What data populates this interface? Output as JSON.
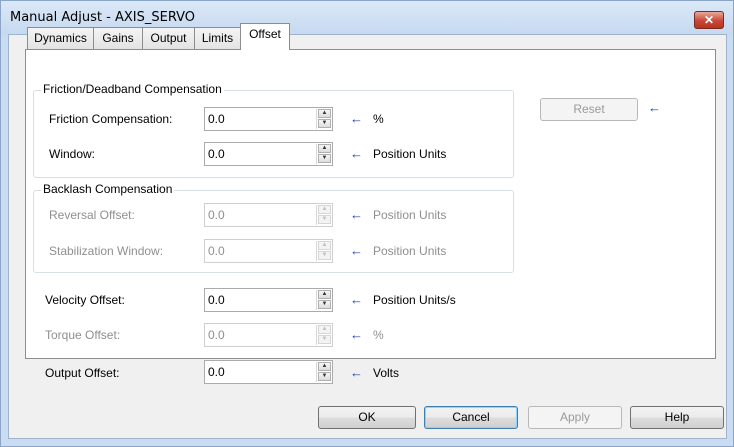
{
  "window": {
    "title": "Manual Adjust - AXIS_SERVO",
    "close_glyph": "✕"
  },
  "tabs": [
    {
      "label": "Dynamics"
    },
    {
      "label": "Gains"
    },
    {
      "label": "Output"
    },
    {
      "label": "Limits"
    },
    {
      "label": "Offset"
    }
  ],
  "friction": {
    "title": "Friction/Deadband Compensation",
    "friction_comp": {
      "label": "Friction Compensation:",
      "value": "0.0",
      "unit": "%"
    },
    "window": {
      "label": "Window:",
      "value": "0.0",
      "unit": "Position Units"
    }
  },
  "backlash": {
    "title": "Backlash Compensation",
    "reversal_offset": {
      "label": "Reversal Offset:",
      "value": "0.0",
      "unit": "Position Units"
    },
    "stabilization_window": {
      "label": "Stabilization Window:",
      "value": "0.0",
      "unit": "Position Units"
    }
  },
  "offsets": {
    "velocity": {
      "label": "Velocity Offset:",
      "value": "0.0",
      "unit": "Position Units/s"
    },
    "torque": {
      "label": "Torque Offset:",
      "value": "0.0",
      "unit": "%"
    },
    "output": {
      "label": "Output Offset:",
      "value": "0.0",
      "unit": "Volts"
    }
  },
  "reset_label": "Reset",
  "arrow_glyph": "←",
  "spin": {
    "up": "▲",
    "down": "▼"
  },
  "buttons": {
    "ok": "OK",
    "cancel": "Cancel",
    "apply": "Apply",
    "help": "Help"
  },
  "colors": {
    "arrow": "#1e3da6",
    "disabled_text": "#8f8f8f",
    "close": "#c9483a"
  }
}
